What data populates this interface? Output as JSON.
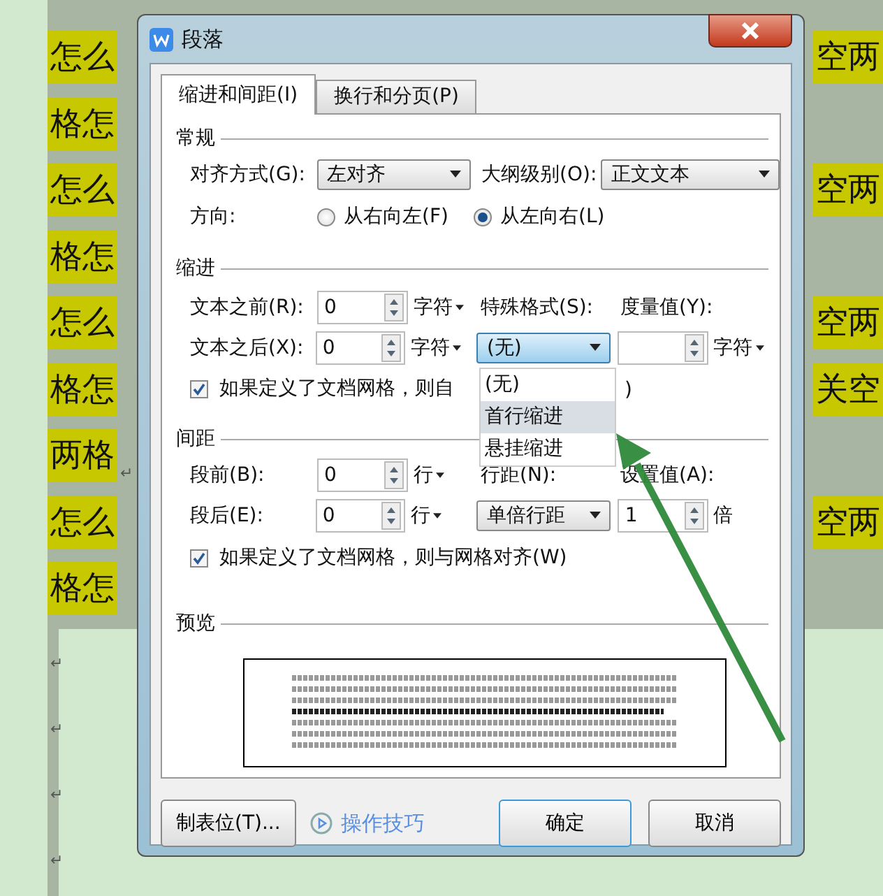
{
  "document": {
    "lines": [
      {
        "left": "怎么",
        "right": "空两"
      },
      {
        "left": "格怎"
      },
      {
        "left": "怎么",
        "right": "空两"
      },
      {
        "left": "格怎"
      },
      {
        "left": "怎么",
        "right": "空两"
      },
      {
        "left": "格怎",
        "right": "关空"
      },
      {
        "left": "两格",
        "mark": "↵"
      },
      {
        "left": "怎么",
        "right": "空两"
      },
      {
        "left": "格怎"
      }
    ],
    "empty_paragraphs": [
      "↵",
      "↵",
      "↵",
      "↵"
    ]
  },
  "dialog": {
    "title": "段落",
    "tabs": [
      {
        "label": "缩进和间距(I)",
        "selected": true
      },
      {
        "label": "换行和分页(P)",
        "selected": false
      }
    ],
    "general": {
      "title": "常规",
      "alignment": {
        "label": "对齐方式(G):",
        "value": "左对齐"
      },
      "outline": {
        "label": "大纲级别(O):",
        "value": "正文文本"
      },
      "direction": {
        "label": "方向:",
        "options": [
          {
            "label": "从右向左(F)",
            "selected": false
          },
          {
            "label": "从左向右(L)",
            "selected": true
          }
        ]
      }
    },
    "indent": {
      "title": "缩进",
      "before": {
        "label": "文本之前(R):",
        "value": "0",
        "unit": "字符"
      },
      "after": {
        "label": "文本之后(X):",
        "value": "0",
        "unit": "字符"
      },
      "special": {
        "label": "特殊格式(S):",
        "value": "(无)"
      },
      "measure": {
        "label": "度量值(Y):",
        "unit": "字符"
      },
      "grid_check": {
        "label": "如果定义了文档网格，则自",
        "tail": ")",
        "checked": true
      },
      "special_options": [
        {
          "label": "(无)",
          "selected": false
        },
        {
          "label": "首行缩进",
          "selected": true
        },
        {
          "label": "悬挂缩进",
          "selected": false
        }
      ]
    },
    "spacing": {
      "title": "间距",
      "before": {
        "label": "段前(B):",
        "value": "0",
        "unit": "行"
      },
      "after": {
        "label": "段后(E):",
        "value": "0",
        "unit": "行"
      },
      "line": {
        "label": "行距(N):",
        "value": "单倍行距"
      },
      "set_value": {
        "label": "设置值(A):",
        "value": "1",
        "unit": "倍"
      },
      "grid_check": {
        "label": "如果定义了文档网格，则与网格对齐(W)",
        "checked": true
      }
    },
    "preview": {
      "title": "预览"
    },
    "buttons": {
      "tabs": "制表位(T)...",
      "tips": "操作技巧",
      "ok": "确定",
      "cancel": "取消"
    }
  }
}
